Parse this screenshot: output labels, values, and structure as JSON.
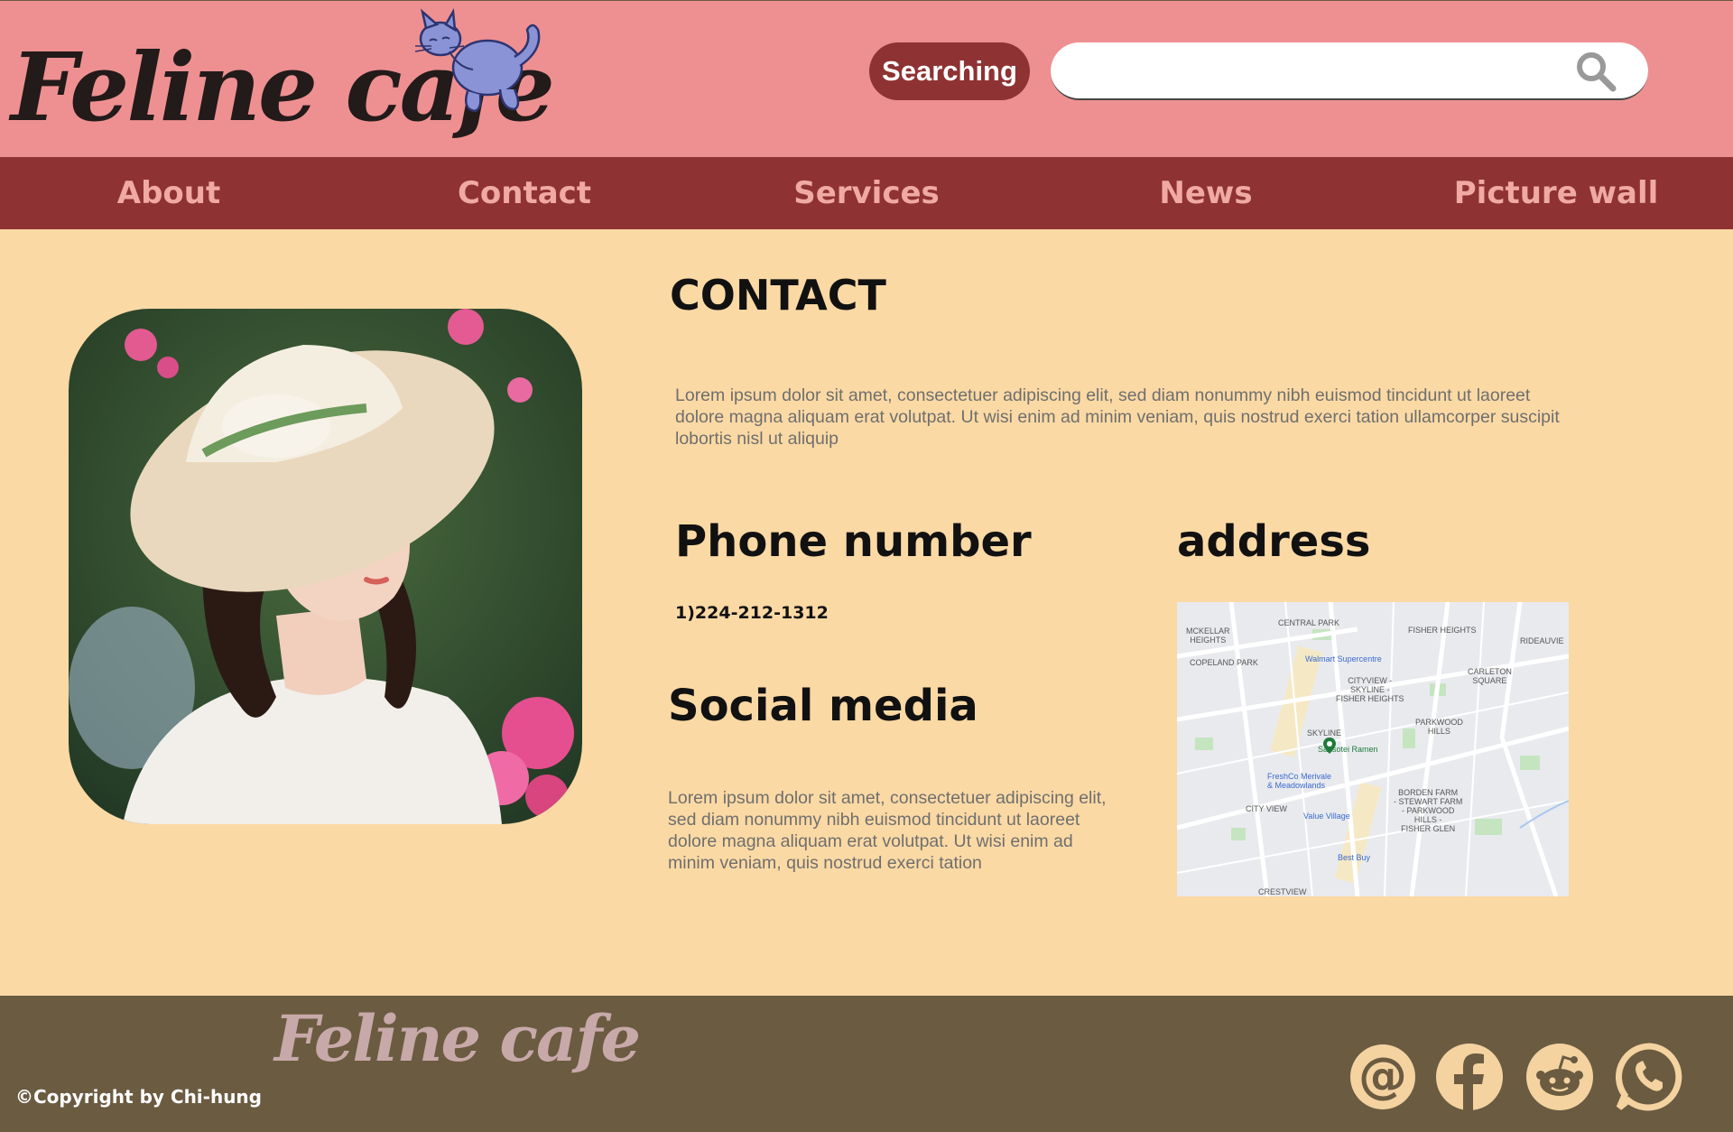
{
  "header": {
    "logo": "Feline cafe",
    "search_button_label": "Searching",
    "search_value": "",
    "search_placeholder": ""
  },
  "nav": {
    "items": [
      {
        "label": "About"
      },
      {
        "label": "Contact"
      },
      {
        "label": "Services"
      },
      {
        "label": "News"
      },
      {
        "label": "Picture wall"
      }
    ]
  },
  "main": {
    "heading": "CONTACT",
    "intro": "Lorem ipsum dolor sit amet, consectetuer adipiscing elit, sed diam nonummy nibh euismod tincidunt ut laoreet dolore magna aliquam erat volutpat. Ut wisi enim ad minim veniam, quis nostrud exerci tation ullamcorper suscipit lobortis nisl ut aliquip",
    "phone_heading": "Phone number",
    "phone_value": "1)224-212-1312",
    "social_heading": "Social media",
    "social_text": "Lorem ipsum dolor sit amet, consectetuer adipiscing elit, sed diam nonummy nibh euismod tincidunt ut laoreet dolore magna aliquam erat volutpat. Ut wisi enim ad minim veniam, quis nostrud exerci tation",
    "address_heading": "address"
  },
  "map": {
    "labels": {
      "central_park": "CENTRAL PARK",
      "fisher_heights": "FISHER HEIGHTS",
      "rideauview": "RIDEAUVIE",
      "mckellar": "MCKELLAR\nHEIGHTS",
      "copeland": "COPELAND PARK",
      "walmart": "Walmart Supercentre",
      "carleton": "CARLETON\nSQUARE",
      "cityview": "CITYVIEW -\nSKYLINE -\nFISHER HEIGHTS",
      "parkwood": "PARKWOOD\nHILLS",
      "skyline": "SKYLINE",
      "sansotei": "Sansotei Ramen",
      "freshco": "FreshCo Merivale\n& Meadowlands",
      "borden": "BORDEN FARM\n- STEWART FARM\n- PARKWOOD\nHILLS -\nFISHER GLEN",
      "city_view": "CITY VIEW",
      "value_village": "Value Village",
      "best_buy": "Best Buy",
      "crestview": "CRESTVIEW"
    }
  },
  "footer": {
    "logo": "Feline cafe",
    "copyright": "©Copyright by Chi-hung"
  },
  "colors": {
    "header_bg": "#ee9091",
    "nav_bg": "#8e3233",
    "page_bg": "#fbd9a4",
    "footer_bg": "#6b5b41",
    "nav_text": "#f0a9a3",
    "footer_icons": "#f4d3a1"
  }
}
